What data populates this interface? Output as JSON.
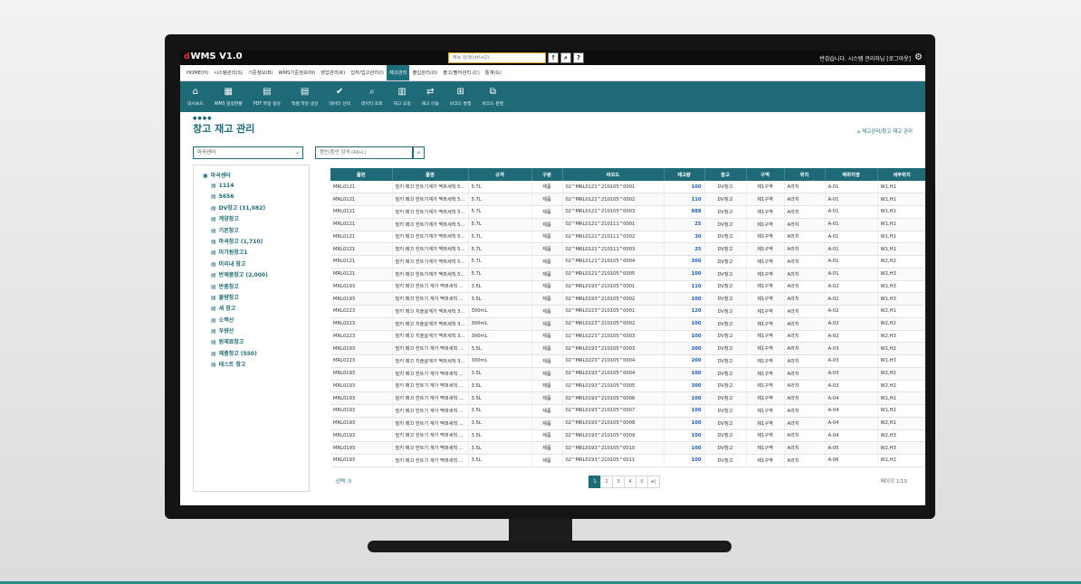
{
  "app": {
    "logo_mark": "d",
    "logo_text": "WMS V1.0",
    "search_placeholder": "메뉴 검색(ctrl+Q)",
    "welcome": "반갑습니다. 시스템 관리자님 [로그아웃]"
  },
  "menu": [
    {
      "label": "HOME(H)",
      "active": false
    },
    {
      "label": "시스템관리(S)",
      "active": false
    },
    {
      "label": "기준정보(B)",
      "active": false
    },
    {
      "label": "WMS기준정보(N)",
      "active": false
    },
    {
      "label": "영업관리(K)",
      "active": false
    },
    {
      "label": "입하/입고관리(I)",
      "active": false
    },
    {
      "label": "재고관리",
      "active": true
    },
    {
      "label": "출입관리(O)",
      "active": false
    },
    {
      "label": "출고/출하관리 (C)",
      "active": false
    },
    {
      "label": "통계(G)",
      "active": false
    }
  ],
  "toolbar": [
    {
      "icon": "home-icon",
      "glyph": "⌂",
      "label": "대시보드"
    },
    {
      "icon": "calendar-icon",
      "glyph": "▦",
      "label": "WMS 일정현황"
    },
    {
      "icon": "pdf-icon",
      "glyph": "▤",
      "label": "PDF 파일 생성"
    },
    {
      "icon": "excel-icon",
      "glyph": "▤",
      "label": "엑셀 파일 생성"
    },
    {
      "icon": "check-icon",
      "glyph": "✔",
      "label": "데이터 선택"
    },
    {
      "icon": "search-icon",
      "glyph": "⌕",
      "label": "데이터 조회"
    },
    {
      "icon": "document-icon",
      "glyph": "▥",
      "label": "재고 조정"
    },
    {
      "icon": "move-icon",
      "glyph": "⇄",
      "label": "재고 이동"
    },
    {
      "icon": "plus-square-icon",
      "glyph": "⊞",
      "label": "바코드 발행"
    },
    {
      "icon": "split-icon",
      "glyph": "⧉",
      "label": "바코드 분할"
    }
  ],
  "page": {
    "dots": "●●●●",
    "title": "창고 재고 관리",
    "breadcrumb": "재고관리/창고 재고 관리"
  },
  "filters": {
    "center_select": "마곡센터",
    "item_search_placeholder": "품번/품번 검색 (Alt+L)"
  },
  "tree": {
    "root": "마곡센터",
    "nodes": [
      "1114",
      "5656",
      "DV창고 (31,082)",
      "계양창고",
      "기본창고",
      "마곡창고 (1,710)",
      "미가원창고1",
      "미리내 창고",
      "반제품창고 (2,000)",
      "반품창고",
      "불량창고",
      "새 창고",
      "소백산",
      "우량산",
      "원재료창고",
      "제품창고 (550)",
      "테스트 창고"
    ]
  },
  "table": {
    "columns": [
      "품번",
      "품명",
      "규격",
      "구분",
      "바코드",
      "재고량",
      "창고",
      "구역",
      "위치",
      "랙위치명",
      "세부위치"
    ],
    "rows": [
      [
        "MRL0121",
        "밀키 매끄 힌트기계가 맥퍼세척 5...",
        "5.7L",
        "제품",
        "02^MRL0121^210105^0001",
        "100",
        "DV창고",
        "제1구역",
        "A라치",
        "A-01",
        "W1,H1"
      ],
      [
        "MRL0121",
        "밀키 매끄 힌트기계가 맥퍼세척 5...",
        "5.7L",
        "제품",
        "02^MRL0121^210105^0002",
        "110",
        "DV창고",
        "제1구역",
        "A라치",
        "A-01",
        "W1,H1"
      ],
      [
        "MRL0121",
        "밀키 매끄 힌트기계가 맥퍼세척 5...",
        "5.7L",
        "제품",
        "02^MRL0121^210105^0003",
        "888",
        "DV창고",
        "제1구역",
        "A라치",
        "A-01",
        "W1,H1"
      ],
      [
        "MRL0121",
        "밀키 매끄 힌트기계가 맥퍼세척 5...",
        "5.7L",
        "제품",
        "02^MRL0121^210111^0001",
        "25",
        "DV창고",
        "제1구역",
        "A라치",
        "A-01",
        "W1,H1"
      ],
      [
        "MRL0121",
        "밀키 매끄 힌트기계가 맥퍼세척 5...",
        "5.7L",
        "제품",
        "02^MRL0121^210111^0002",
        "30",
        "DV창고",
        "제1구역",
        "A라치",
        "A-01",
        "W1,H1"
      ],
      [
        "MRL0121",
        "밀키 매끄 힌트기계가 맥퍼세척 5...",
        "5.7L",
        "제품",
        "02^MRL0121^210111^0003",
        "25",
        "DV창고",
        "제1구역",
        "A라치",
        "A-01",
        "W1,H1"
      ],
      [
        "MRL0121",
        "밀키 매끄 힌트기계가 맥퍼세척 5...",
        "5.7L",
        "제품",
        "02^MRL0121^210105^0004",
        "300",
        "DV창고",
        "제1구역",
        "A라치",
        "A-01",
        "W2,H2"
      ],
      [
        "MRL0121",
        "밀키 매끄 힌트기계가 맥퍼세척 5...",
        "5.7L",
        "제품",
        "02^MRL0121^210105^0005",
        "100",
        "DV창고",
        "제1구역",
        "A라치",
        "A-01",
        "W2,H3"
      ],
      [
        "MRL0193",
        "밀키 매끄 힌트기 계가 맥퍼세척 ...",
        "3.5L",
        "제품",
        "02^MRL0193^210105^0001",
        "110",
        "DV창고",
        "제1구역",
        "A라치",
        "A-02",
        "W1,H3"
      ],
      [
        "MRL0193",
        "밀키 매끄 힌트기 계가 맥퍼세척 ...",
        "3.5L",
        "제품",
        "02^MRL0193^210105^0002",
        "100",
        "DV창고",
        "제1구역",
        "A라치",
        "A-02",
        "W1,H3"
      ],
      [
        "MRL0223",
        "밀키 매끄 치솔살계가 맥퍼세척 3...",
        "300mL",
        "제품",
        "02^MRL0223^210105^0001",
        "120",
        "DV창고",
        "제1구역",
        "A라치",
        "A-02",
        "W2,H1"
      ],
      [
        "MRL0223",
        "밀키 매끄 치솔살계가 맥퍼세척 3...",
        "300mL",
        "제품",
        "02^MRL0223^210105^0002",
        "100",
        "DV창고",
        "제1구역",
        "A라치",
        "A-02",
        "W2,H2"
      ],
      [
        "MRL0223",
        "밀키 매끄 치솔살계가 맥퍼세척 3...",
        "300mL",
        "제품",
        "02^MRL0223^210105^0003",
        "100",
        "DV창고",
        "제1구역",
        "A라치",
        "A-02",
        "W2,H3"
      ],
      [
        "MRL0193",
        "밀키 매끄 힌트기 계가 맥퍼세척 ...",
        "3.5L",
        "제품",
        "02^MRL0193^210105^0003",
        "200",
        "DV창고",
        "제1구역",
        "A라치",
        "A-03",
        "W1,H2"
      ],
      [
        "MRL0223",
        "밀키 매끄 치솔살계가 맥퍼세척 3...",
        "300mL",
        "제품",
        "02^MRL0223^210105^0004",
        "200",
        "DV창고",
        "제1구역",
        "A라치",
        "A-03",
        "W1,H3"
      ],
      [
        "MRL0193",
        "밀키 매끄 힌트기 계가 맥퍼세척 ...",
        "3.5L",
        "제품",
        "02^MRL0193^210105^0004",
        "100",
        "DV창고",
        "제1구역",
        "A라치",
        "A-03",
        "W2,H2"
      ],
      [
        "MRL0193",
        "밀키 매끄 힌트기 계가 맥퍼세척 ...",
        "3.5L",
        "제품",
        "02^MRL0193^210105^0005",
        "300",
        "DV창고",
        "제1구역",
        "A라치",
        "A-03",
        "W2,H2"
      ],
      [
        "MRL0193",
        "밀키 매끄 힌트기 계가 맥퍼세척 ...",
        "3.5L",
        "제품",
        "02^MRL0193^210105^0006",
        "100",
        "DV창고",
        "제1구역",
        "A라치",
        "A-04",
        "W1,H1"
      ],
      [
        "MRL0193",
        "밀키 매끄 힌트기 계가 맥퍼세척 ...",
        "3.5L",
        "제품",
        "02^MRL0193^210105^0007",
        "100",
        "DV창고",
        "제1구역",
        "A라치",
        "A-04",
        "W1,H2"
      ],
      [
        "MRL0193",
        "밀키 매끄 힌트기 계가 맥퍼세척 ...",
        "3.5L",
        "제품",
        "02^MRL0193^210105^0008",
        "100",
        "DV창고",
        "제1구역",
        "A라치",
        "A-04",
        "W2,H1"
      ],
      [
        "MRL0193",
        "밀키 매끄 힌트기 계가 맥퍼세척 ...",
        "3.5L",
        "제품",
        "02^MRL0193^210105^0009",
        "100",
        "DV창고",
        "제1구역",
        "A라치",
        "A-04",
        "W2,H3"
      ],
      [
        "MRL0193",
        "밀키 매끄 힌트기 계가 맥퍼세척 ...",
        "3.5L",
        "제품",
        "02^MRL0193^210105^0010",
        "100",
        "DV창고",
        "제1구역",
        "A라치",
        "A-05",
        "W2,H3"
      ],
      [
        "MRL0193",
        "밀키 매끄 힌트기 계가 맥퍼세척 ...",
        "3.5L",
        "제품",
        "02^MRL0193^210105^0011",
        "100",
        "DV창고",
        "제1구역",
        "A라치",
        "A-06",
        "W1,H1"
      ]
    ]
  },
  "footer": {
    "selected": "선택: 0",
    "pages": [
      "1",
      "2",
      "3",
      "4",
      "5",
      "▸|"
    ],
    "active_page": "1",
    "page_info": "페이지 1/10"
  },
  "colors": {
    "primary": "#1e6a78",
    "menu_active": "#1e6f7e",
    "qty_text": "#1a5fb4",
    "logo_mark": "#e03a2e"
  }
}
